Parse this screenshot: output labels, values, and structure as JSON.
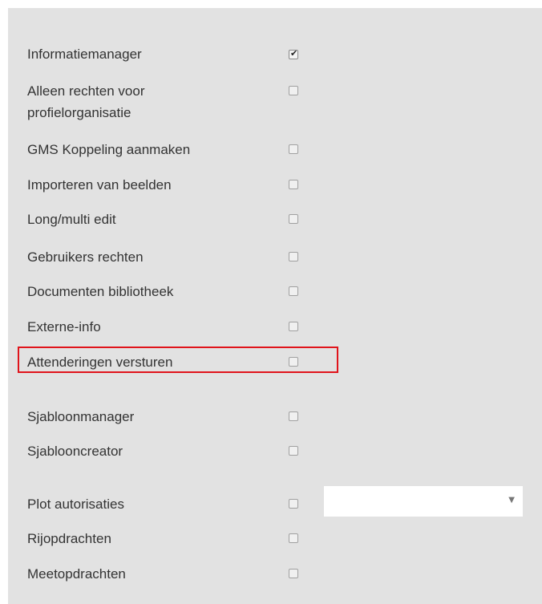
{
  "permissions": [
    {
      "label": "Informatiemanager",
      "checked": true
    },
    {
      "label": "Alleen rechten voor\nprofielorganisatie",
      "checked": false
    },
    {
      "label": "GMS Koppeling aanmaken",
      "checked": false
    },
    {
      "label": "Importeren van beelden",
      "checked": false
    },
    {
      "label": "Long/multi edit",
      "checked": false
    },
    {
      "label": "Gebruikers rechten",
      "checked": false
    },
    {
      "label": "Documenten bibliotheek",
      "checked": false
    },
    {
      "label": "Externe-info",
      "checked": false
    },
    {
      "label": "Attenderingen versturen",
      "checked": false
    },
    {
      "label": "Sjabloonmanager",
      "checked": false
    },
    {
      "label": "Sjablooncreator",
      "checked": false
    },
    {
      "label": "Plot autorisaties",
      "checked": false
    },
    {
      "label": "Rijopdrachten",
      "checked": false
    },
    {
      "label": "Meetopdrachten",
      "checked": false
    }
  ],
  "plot_select": {
    "value": ""
  },
  "icons": {
    "check": "checkmark-icon",
    "caret": "caret-down-icon"
  }
}
